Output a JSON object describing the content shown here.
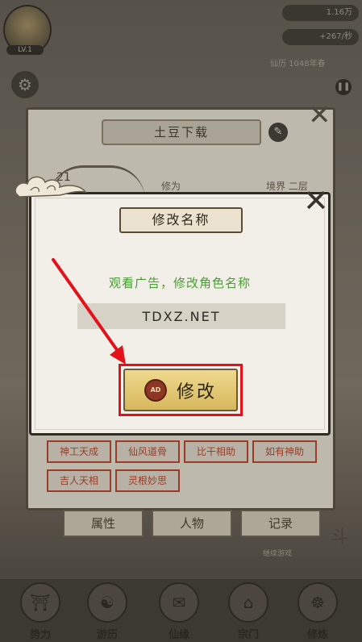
{
  "hud": {
    "level": "LV.1",
    "resource1": "1.16万",
    "resource2": "+267/秒",
    "status_line": "仙历  1048年春"
  },
  "back_panel": {
    "title": "土豆下载",
    "number": "21",
    "label_left": "修为",
    "label_right": "境界 二层",
    "traits": [
      "神工天成",
      "仙风道骨",
      "比干相助",
      "如有神助",
      "吉人天相",
      "灵根妙思"
    ],
    "tabs": [
      "属性",
      "人物",
      "记录"
    ],
    "footnote": "继续游戏",
    "side_char": "斗"
  },
  "bottom_nav": {
    "items": [
      "势力",
      "游历",
      "仙缘",
      "宗门",
      "修炼"
    ]
  },
  "dialog": {
    "title": "修改名称",
    "hint": "观看广告，修改角色名称",
    "name_value": "TDXZ.NET",
    "ad_icon_text": "AD",
    "confirm_label": "修改",
    "close_icon": "close-x-icon"
  },
  "colors": {
    "hint_green": "#4a9c34",
    "highlight_red": "#e3111a",
    "button_gold": "#e5c873"
  }
}
